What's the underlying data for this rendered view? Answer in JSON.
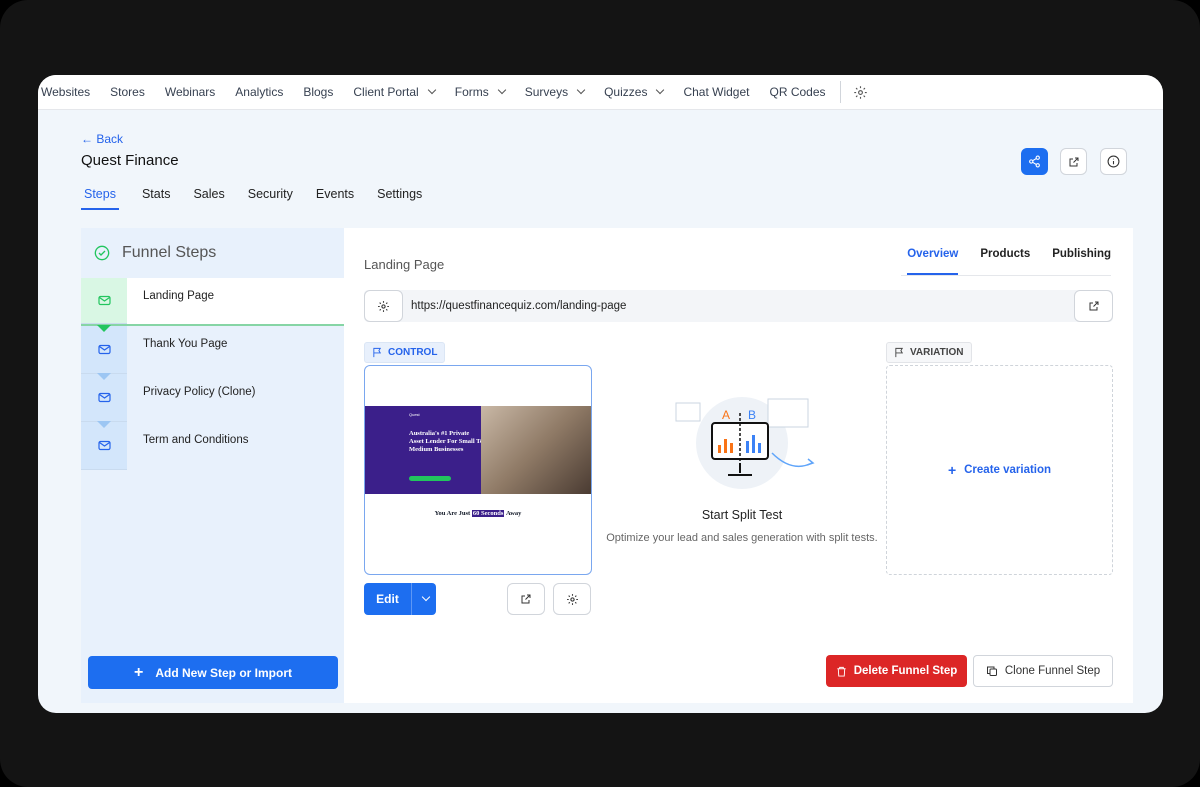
{
  "nav": {
    "items": [
      {
        "label": "Websites"
      },
      {
        "label": "Stores"
      },
      {
        "label": "Webinars"
      },
      {
        "label": "Analytics"
      },
      {
        "label": "Blogs"
      },
      {
        "label": "Client Portal",
        "dropdown": true
      },
      {
        "label": "Forms",
        "dropdown": true
      },
      {
        "label": "Surveys",
        "dropdown": true
      },
      {
        "label": "Quizzes",
        "dropdown": true
      },
      {
        "label": "Chat Widget"
      },
      {
        "label": "QR Codes"
      }
    ]
  },
  "header": {
    "back": "← Back",
    "title": "Quest Finance",
    "tabs": [
      "Steps",
      "Stats",
      "Sales",
      "Security",
      "Events",
      "Settings"
    ],
    "active_tab": "Steps"
  },
  "sidebar": {
    "title": "Funnel Steps",
    "steps": [
      "Landing Page",
      "Thank You Page",
      "Privacy Policy (Clone)",
      "Term and Conditions"
    ],
    "active": "Landing Page",
    "add_button": "Add New Step or Import"
  },
  "main": {
    "title": "Landing Page",
    "tabs": [
      "Overview",
      "Products",
      "Publishing"
    ],
    "active_tab": "Overview",
    "url": "https://questfinancequiz.com/landing-page",
    "control_label": "CONTROL",
    "variation_label": "VARIATION",
    "preview": {
      "brand": "Quest",
      "headline": "Australia's #1 Private Asset Lender For Small To Medium Businesses",
      "sub_before": "You Are Just",
      "sub_highlight": "60 Seconds",
      "sub_after": "Away"
    },
    "edit_label": "Edit",
    "split_title": "Start Split Test",
    "split_desc": "Optimize your lead and sales generation with split tests.",
    "create_variation": "Create variation",
    "delete_label": "Delete Funnel Step",
    "clone_label": "Clone Funnel Step"
  },
  "colors": {
    "accent": "#1d6ef0",
    "danger": "#dc2626",
    "success": "#22c55e"
  }
}
